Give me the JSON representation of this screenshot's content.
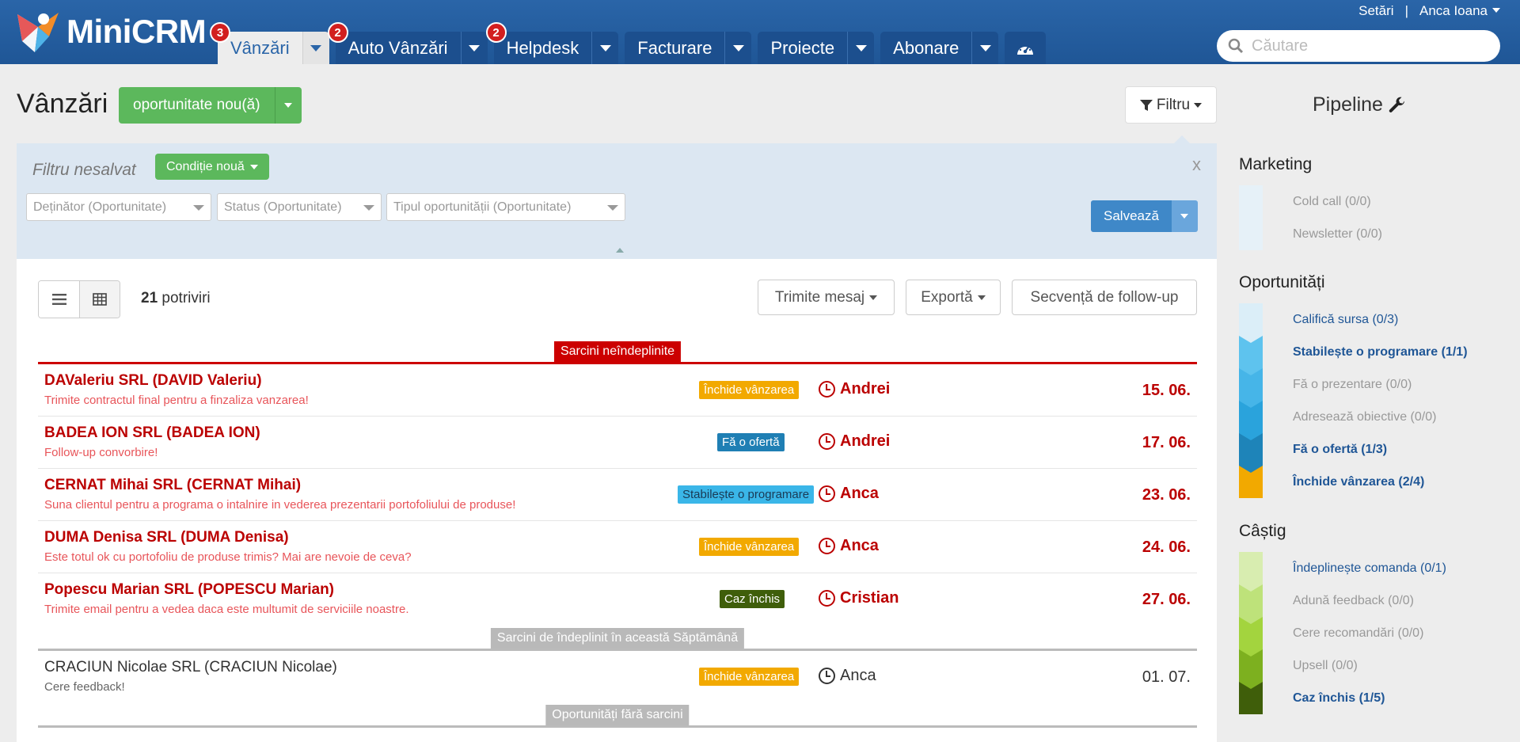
{
  "app": {
    "name": "MiniCRM"
  },
  "nav": {
    "tabs": [
      {
        "label": "Vânzări",
        "badge": "3"
      },
      {
        "label": "Auto Vânzări",
        "badge": "2"
      },
      {
        "label": "Helpdesk",
        "badge": "2"
      },
      {
        "label": "Facturare",
        "badge": ""
      },
      {
        "label": "Proiecte",
        "badge": ""
      },
      {
        "label": "Abonare",
        "badge": ""
      }
    ],
    "settings_label": "Setări",
    "separator": "|",
    "user_label": "Anca Ioana",
    "search_placeholder": "Căutare"
  },
  "page": {
    "title": "Vânzări",
    "new_button": "oportunitate nou(ă)",
    "filter_button": "Filtru"
  },
  "filter": {
    "title": "Filtru nesalvat",
    "add_condition": "Condiție nouă",
    "close": "x",
    "selects": [
      "Deținător (Oportunitate)",
      "Status (Oportunitate)",
      "Tipul oportunității (Oportunitate)"
    ],
    "save_button": "Salvează"
  },
  "results": {
    "count": "21",
    "count_label": "potriviri",
    "actions": [
      "Trimite mesaj",
      "Exportă",
      "Secvență de follow-up"
    ],
    "sections": [
      "Sarcini neîndeplinite",
      "Sarcini de îndeplinit în această Săptămână",
      "Oportunități fără sarcini"
    ],
    "rows": [
      {
        "name": "DAValeriu SRL (DAVID Valeriu)",
        "desc": "Trimite contractul final pentru a finzaliza vanzarea!",
        "stage": "Închide vânzarea",
        "stage_color": "#f2a900",
        "owner": "Andrei",
        "date": "15. 06."
      },
      {
        "name": "BADEA ION SRL (BADEA ION)",
        "desc": "Follow-up convorbire!",
        "stage": "Fă o ofertă",
        "stage_color": "#1f7fb4",
        "owner": "Andrei",
        "date": "17. 06."
      },
      {
        "name": "CERNAT Mihai SRL (CERNAT Mihai)",
        "desc": "Suna clientul pentru a programa o intalnire in vederea prezentarii portofoliului de produse!",
        "stage": "Stabilește o programare",
        "stage_color": "#3ab6e8",
        "stage_text_color": "#222",
        "owner": "Anca",
        "date": "23. 06."
      },
      {
        "name": "DUMA Denisa SRL (DUMA Denisa)",
        "desc": "Este totul ok cu portofoliu de produse trimis? Mai are nevoie de ceva?",
        "stage": "Închide vânzarea",
        "stage_color": "#f2a900",
        "owner": "Anca",
        "date": "24. 06."
      },
      {
        "name": "Popescu Marian SRL (POPESCU Marian)",
        "desc": "Trimite email pentru a vedea daca este multumit de serviciile noastre.",
        "stage": "Caz închis",
        "stage_color": "#3f5e0a",
        "owner": "Cristian",
        "date": "27. 06."
      },
      {
        "name": "CRACIUN Nicolae SRL (CRACIUN Nicolae)",
        "desc": "Cere feedback!",
        "stage": "Închide vânzarea",
        "stage_color": "#f2a900",
        "owner": "Anca",
        "date": "01. 07."
      }
    ]
  },
  "pipeline": {
    "title": "Pipeline",
    "groups": [
      {
        "label": "Marketing",
        "items": [
          {
            "label": "Cold call (0/0)",
            "color": "#e6f1f8"
          },
          {
            "label": "Newsletter (0/0)",
            "color": "#e6f1f8"
          }
        ]
      },
      {
        "label": "Oportunități",
        "items": [
          {
            "label": "Califică sursa (0/3)",
            "color": "#dbeef8"
          },
          {
            "label": "Stabilește o programare (1/1)",
            "color": "#5ec3ee"
          },
          {
            "label": "Fă o prezentare (0/0)",
            "color": "#46b5e8"
          },
          {
            "label": "Adresează obiective (0/0)",
            "color": "#2aa3dc"
          },
          {
            "label": "Fă o ofertă (1/3)",
            "color": "#1e84b9"
          },
          {
            "label": "Închide vânzarea (2/4)",
            "color": "#f2a900"
          }
        ]
      },
      {
        "label": "Câștig",
        "items": [
          {
            "label": "Îndeplinește comanda (0/1)",
            "color": "#d8edb0"
          },
          {
            "label": "Adună feedback (0/0)",
            "color": "#bee27a"
          },
          {
            "label": "Cere recomandări (0/0)",
            "color": "#a3d43e"
          },
          {
            "label": "Upsell (0/0)",
            "color": "#7db01f"
          },
          {
            "label": "Caz închis (1/5)",
            "color": "#3f5e0a"
          }
        ]
      }
    ]
  }
}
